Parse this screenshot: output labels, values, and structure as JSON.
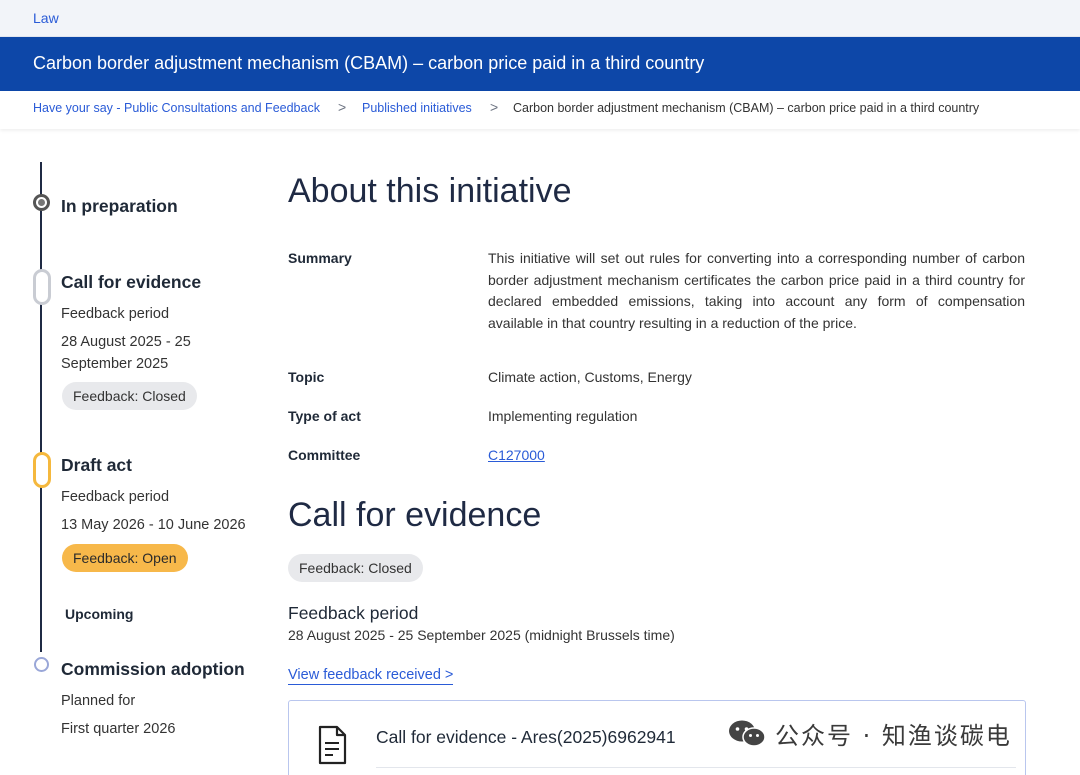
{
  "topbar": {
    "label": "Law"
  },
  "banner": {
    "title": "Carbon border adjustment mechanism (CBAM) – carbon price paid in a third country"
  },
  "breadcrumb": {
    "items": [
      "Have your say - Public Consultations and Feedback",
      "Published initiatives",
      "Carbon border adjustment mechanism (CBAM) – carbon price paid in a third country"
    ],
    "separator": ">"
  },
  "timeline": {
    "stage1": {
      "title": "In preparation"
    },
    "stage2": {
      "title": "Call for evidence",
      "period_label": "Feedback period",
      "dates_line1": "28 August 2025 - 25",
      "dates_line2": "September 2025",
      "badge": "Feedback: Closed"
    },
    "stage3": {
      "title": "Draft act",
      "period_label": "Feedback period",
      "dates": "13 May 2026 - 10 June 2026",
      "badge": "Feedback: Open"
    },
    "upcoming_label": "Upcoming",
    "stage4": {
      "title": "Commission adoption",
      "planned_label": "Planned for",
      "planned_value": "First quarter 2026"
    }
  },
  "about": {
    "heading": "About this initiative",
    "summary_label": "Summary",
    "summary_text": "This initiative will set out rules for converting into a corresponding number of carbon border adjustment mechanism certificates the carbon price paid in a third country for declared embedded emissions, taking into account any form of compensation available in that country resulting in a reduction of the price.",
    "topic_label": "Topic",
    "topic_value": "Climate action, Customs, Energy",
    "type_label": "Type of act",
    "type_value": "Implementing regulation",
    "committee_label": "Committee",
    "committee_value": "C127000"
  },
  "call_for_evidence": {
    "heading": "Call for evidence",
    "badge": "Feedback: Closed",
    "period_title": "Feedback period",
    "period_dates": "28 August 2025 - 25 September 2025  (midnight Brussels time)",
    "view_link": "View feedback received >",
    "document_title": "Call for evidence - Ares(2025)6962941"
  },
  "watermark": {
    "text": "公众号 · 知渔谈碳电"
  },
  "colors": {
    "banner_bg": "#0d47a8",
    "link": "#2a5bd7",
    "badge_open": "#f7b84a",
    "badge_closed": "#e8e9ec"
  },
  "icons": [
    "document-icon",
    "wechat-icon"
  ]
}
